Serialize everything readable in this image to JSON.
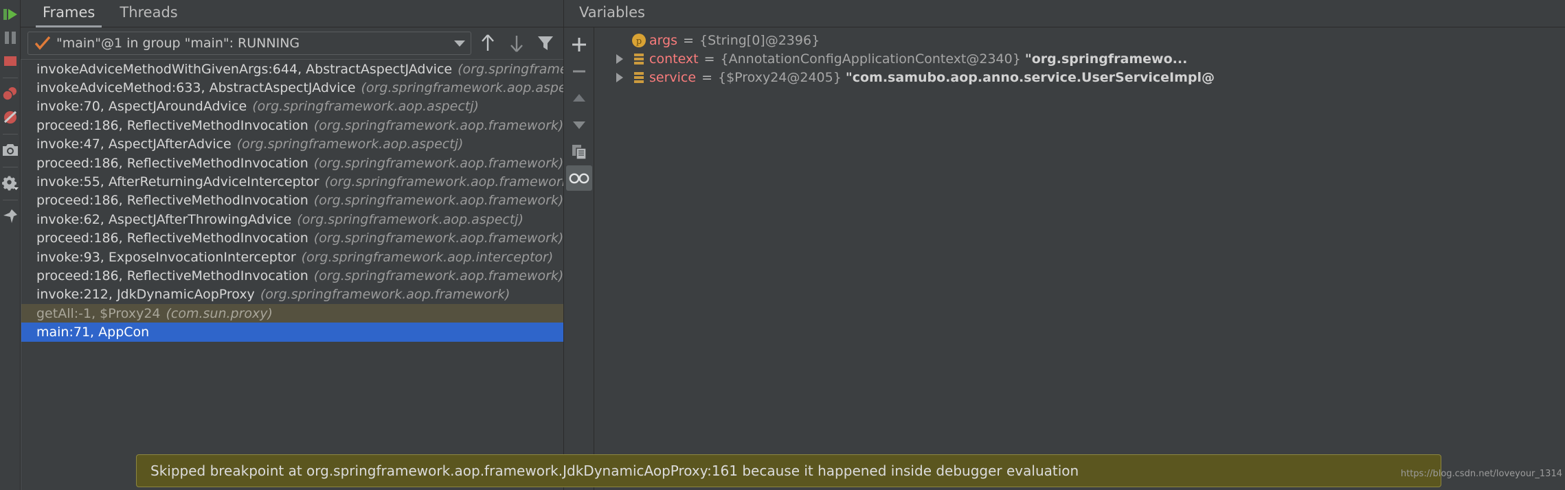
{
  "colors": {
    "background": "#3c3f41",
    "panel_border": "#2b2b2b",
    "selection_blue": "#2f65ca",
    "library_frame": "#55513f",
    "tooltip_bg": "#5b561f",
    "variable_name": "#f97c7c",
    "resume_green": "#62b543",
    "stop_red": "#c75450",
    "param_icon_yellow": "#d9a334"
  },
  "left_rail": {
    "buttons": [
      {
        "name": "resume-program",
        "icon": "resume-icon"
      },
      {
        "name": "pause-program",
        "icon": "pause-icon"
      },
      {
        "name": "stop",
        "icon": "stop-icon"
      },
      {
        "name": "view-breakpoints",
        "icon": "breakpoints-icon"
      },
      {
        "name": "mute-breakpoints",
        "icon": "mute-breakpoints-icon"
      },
      {
        "name": "screenshot",
        "icon": "camera-icon"
      },
      {
        "name": "settings",
        "icon": "gear-icon"
      },
      {
        "name": "pin-tab",
        "icon": "pin-icon"
      }
    ]
  },
  "frames_panel": {
    "tabs": [
      {
        "label": "Frames",
        "active": true
      },
      {
        "label": "Threads",
        "active": false
      }
    ],
    "thread_selector": {
      "value": "\"main\"@1 in group \"main\": RUNNING",
      "status_icon": "checkmark-icon"
    },
    "toolbar": [
      {
        "name": "frames-up",
        "icon": "arrow-up-icon"
      },
      {
        "name": "frames-down",
        "icon": "arrow-down-icon"
      },
      {
        "name": "frames-filter",
        "icon": "filter-icon"
      }
    ],
    "frames": [
      {
        "method": "invokeAdviceMethodWithGivenArgs:644, AbstractAspectJAdvice",
        "package": "(org.springframework.a",
        "style": "normal"
      },
      {
        "method": "invokeAdviceMethod:633, AbstractAspectJAdvice",
        "package": "(org.springframework.aop.aspectj)",
        "style": "normal"
      },
      {
        "method": "invoke:70, AspectJAroundAdvice",
        "package": "(org.springframework.aop.aspectj)",
        "style": "normal"
      },
      {
        "method": "proceed:186, ReflectiveMethodInvocation",
        "package": "(org.springframework.aop.framework)",
        "style": "normal"
      },
      {
        "method": "invoke:47, AspectJAfterAdvice",
        "package": "(org.springframework.aop.aspectj)",
        "style": "normal"
      },
      {
        "method": "proceed:186, ReflectiveMethodInvocation",
        "package": "(org.springframework.aop.framework)",
        "style": "normal"
      },
      {
        "method": "invoke:55, AfterReturningAdviceInterceptor",
        "package": "(org.springframework.aop.framework.adap",
        "style": "normal"
      },
      {
        "method": "proceed:186, ReflectiveMethodInvocation",
        "package": "(org.springframework.aop.framework)",
        "style": "normal"
      },
      {
        "method": "invoke:62, AspectJAfterThrowingAdvice",
        "package": "(org.springframework.aop.aspectj)",
        "style": "normal"
      },
      {
        "method": "proceed:186, ReflectiveMethodInvocation",
        "package": "(org.springframework.aop.framework)",
        "style": "normal"
      },
      {
        "method": "invoke:93, ExposeInvocationInterceptor",
        "package": "(org.springframework.aop.interceptor)",
        "style": "normal"
      },
      {
        "method": "proceed:186, ReflectiveMethodInvocation",
        "package": "(org.springframework.aop.framework)",
        "style": "normal"
      },
      {
        "method": "invoke:212, JdkDynamicAopProxy",
        "package": "(org.springframework.aop.framework)",
        "style": "normal"
      },
      {
        "method": "getAll:-1, $Proxy24",
        "package": "(com.sun.proxy)",
        "style": "library"
      },
      {
        "method": "main:71, AppCon",
        "package": "",
        "style": "selected"
      }
    ]
  },
  "variables_panel": {
    "title": "Variables",
    "toolbar": [
      {
        "name": "add-watch",
        "icon": "plus-icon"
      },
      {
        "name": "remove-watch",
        "icon": "minus-icon"
      },
      {
        "name": "move-watch-up",
        "icon": "triangle-up-icon"
      },
      {
        "name": "move-watch-down",
        "icon": "triangle-down-icon"
      },
      {
        "name": "copy-value",
        "icon": "copy-icon"
      },
      {
        "name": "toggle-watches",
        "icon": "glasses-icon",
        "active": true
      }
    ],
    "variables": [
      {
        "icon": "parameter-icon",
        "expandable": false,
        "name": "args",
        "equals": "=",
        "value": "{String[0]@2396}",
        "string_value": ""
      },
      {
        "icon": "object-icon",
        "expandable": true,
        "name": "context",
        "equals": "=",
        "value": "{AnnotationConfigApplicationContext@2340}",
        "string_value": "\"org.springframewo..."
      },
      {
        "icon": "object-icon",
        "expandable": true,
        "name": "service",
        "equals": "=",
        "value": "{$Proxy24@2405}",
        "string_value": "\"com.samubo.aop.anno.service.UserServiceImpl@"
      }
    ]
  },
  "tooltip": {
    "text": "Skipped breakpoint at org.springframework.aop.framework.JdkDynamicAopProxy:161 because it happened inside debugger evaluation"
  },
  "watermark": {
    "text": "https://blog.csdn.net/loveyour_1314"
  }
}
